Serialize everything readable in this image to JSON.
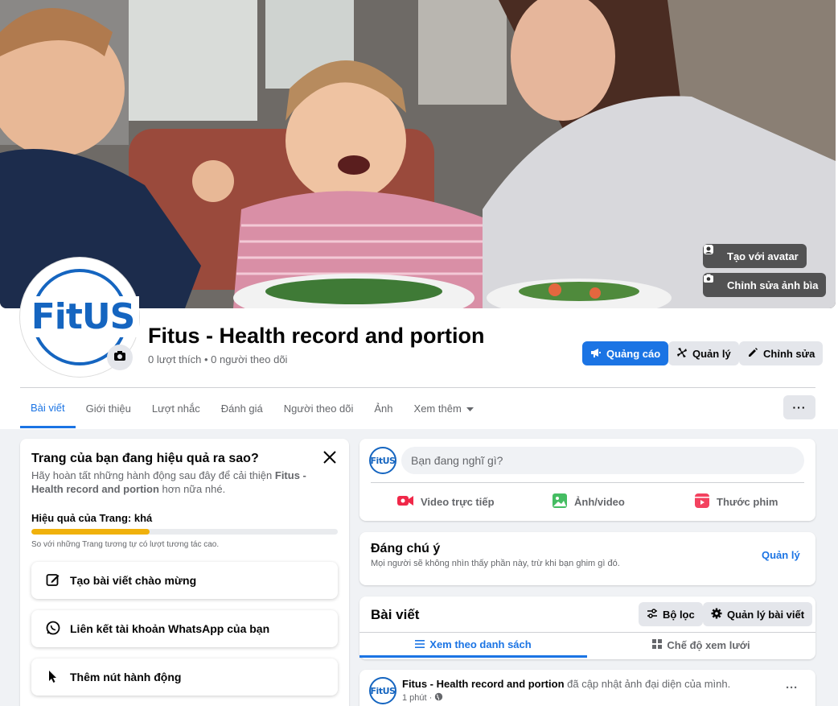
{
  "cover": {
    "create_avatar_label": "Tạo với avatar",
    "edit_cover_label": "Chỉnh sửa ảnh bìa"
  },
  "profile": {
    "logo_text": "FitUS",
    "name": "Fitus - Health record and portion",
    "stats": "0 lượt thích • 0 người theo dõi"
  },
  "actions": {
    "ads_label": "Quảng cáo",
    "manage_label": "Quản lý",
    "edit_label": "Chỉnh sửa"
  },
  "tabs": [
    {
      "label": "Bài viết"
    },
    {
      "label": "Giới thiệu"
    },
    {
      "label": "Lượt nhắc"
    },
    {
      "label": "Đánh giá"
    },
    {
      "label": "Người theo dõi"
    },
    {
      "label": "Ảnh"
    },
    {
      "label": "Xem thêm"
    }
  ],
  "more_label": "···",
  "performance": {
    "title": "Trang của bạn đang hiệu quả ra sao?",
    "desc_prefix": "Hãy hoàn tất những hành động sau đây để cải thiện ",
    "desc_page": "Fitus - Health record and portion",
    "desc_suffix": " hơn nữa nhé.",
    "level": "Hiệu quả của Trang: khá",
    "progress": 0.385,
    "compare": "So với những Trang tương tự có lượt tương tác cao.",
    "items": [
      {
        "label": "Tạo bài viết chào mừng",
        "icon": "edit-square-icon"
      },
      {
        "label": "Liên kết tài khoản WhatsApp của bạn",
        "icon": "whatsapp-icon"
      },
      {
        "label": "Thêm nút hành động",
        "icon": "cursor-icon"
      }
    ]
  },
  "composer": {
    "placeholder": "Bạn đang nghĩ gì?",
    "live_label": "Video trực tiếp",
    "photo_label": "Ảnh/video",
    "reel_label": "Thước phim"
  },
  "featured": {
    "title": "Đáng chú ý",
    "desc": "Mọi người sẽ không nhìn thấy phần này, trừ khi bạn ghim gì đó.",
    "manage_label": "Quản lý"
  },
  "posts": {
    "title": "Bài viết",
    "filter_label": "Bộ lọc",
    "manage_posts_label": "Quản lý bài viết",
    "list_view_label": "Xem theo danh sách",
    "grid_view_label": "Chế độ xem lưới"
  },
  "post": {
    "author": "Fitus - Health record and portion",
    "action": " đã cập nhật ảnh đại diện của mình.",
    "time": "1 phút ·",
    "more": "···"
  },
  "colors": {
    "accent": "#1b74e4",
    "logo_blue": "#1565c0",
    "progress": "#f0b10c"
  }
}
